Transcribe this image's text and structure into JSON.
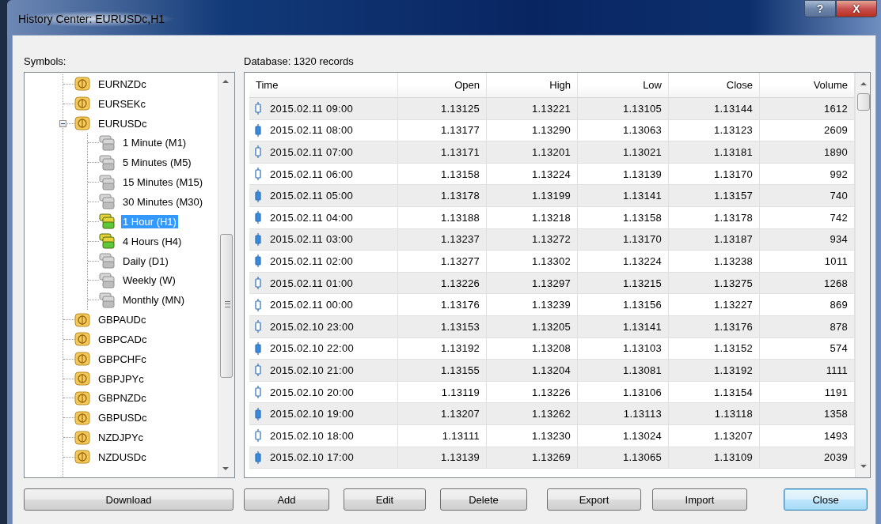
{
  "window": {
    "title": "History Center: EURUSDc,H1",
    "buttons": [
      {
        "kind": "help",
        "label": "?"
      },
      {
        "kind": "close",
        "label": "X"
      }
    ]
  },
  "symbols": {
    "label": "Symbols:",
    "items": [
      {
        "label": "EURNZDc",
        "selected": false
      },
      {
        "label": "EURSEKc",
        "selected": false
      },
      {
        "label": "EURUSDc",
        "selected": false,
        "expanded": true,
        "children": [
          {
            "label": "1 Minute (M1)",
            "selected": false,
            "has_data": false
          },
          {
            "label": "5 Minutes (M5)",
            "selected": false,
            "has_data": false
          },
          {
            "label": "15 Minutes (M15)",
            "selected": false,
            "has_data": false
          },
          {
            "label": "30 Minutes (M30)",
            "selected": false,
            "has_data": false
          },
          {
            "label": "1 Hour (H1)",
            "selected": true,
            "has_data": true
          },
          {
            "label": "4 Hours (H4)",
            "selected": false,
            "has_data": true
          },
          {
            "label": "Daily (D1)",
            "selected": false,
            "has_data": false
          },
          {
            "label": "Weekly (W)",
            "selected": false,
            "has_data": false
          },
          {
            "label": "Monthly (MN)",
            "selected": false,
            "has_data": false
          }
        ]
      },
      {
        "label": "GBPAUDc",
        "selected": false
      },
      {
        "label": "GBPCADc",
        "selected": false
      },
      {
        "label": "GBPCHFc",
        "selected": false
      },
      {
        "label": "GBPJPYc",
        "selected": false
      },
      {
        "label": "GBPNZDc",
        "selected": false
      },
      {
        "label": "GBPUSDc",
        "selected": false
      },
      {
        "label": "NZDJPYc",
        "selected": false
      },
      {
        "label": "NZDUSDc",
        "selected": false
      }
    ]
  },
  "database": {
    "label": "Database: 1320 records",
    "columns": [
      "Time",
      "Open",
      "High",
      "Low",
      "Close",
      "Volume"
    ],
    "rows": [
      {
        "bearish": false,
        "cells": [
          "2015.02.11 09:00",
          "1.13125",
          "1.13221",
          "1.13105",
          "1.13144",
          "1612"
        ]
      },
      {
        "bearish": true,
        "cells": [
          "2015.02.11 08:00",
          "1.13177",
          "1.13290",
          "1.13063",
          "1.13123",
          "2609"
        ]
      },
      {
        "bearish": false,
        "cells": [
          "2015.02.11 07:00",
          "1.13171",
          "1.13201",
          "1.13021",
          "1.13181",
          "1890"
        ]
      },
      {
        "bearish": false,
        "cells": [
          "2015.02.11 06:00",
          "1.13158",
          "1.13224",
          "1.13139",
          "1.13170",
          "992"
        ]
      },
      {
        "bearish": true,
        "cells": [
          "2015.02.11 05:00",
          "1.13178",
          "1.13199",
          "1.13141",
          "1.13157",
          "740"
        ]
      },
      {
        "bearish": true,
        "cells": [
          "2015.02.11 04:00",
          "1.13188",
          "1.13218",
          "1.13158",
          "1.13178",
          "742"
        ]
      },
      {
        "bearish": true,
        "cells": [
          "2015.02.11 03:00",
          "1.13237",
          "1.13272",
          "1.13170",
          "1.13187",
          "934"
        ]
      },
      {
        "bearish": true,
        "cells": [
          "2015.02.11 02:00",
          "1.13277",
          "1.13302",
          "1.13224",
          "1.13238",
          "1011"
        ]
      },
      {
        "bearish": false,
        "cells": [
          "2015.02.11 01:00",
          "1.13226",
          "1.13297",
          "1.13215",
          "1.13275",
          "1268"
        ]
      },
      {
        "bearish": false,
        "cells": [
          "2015.02.11 00:00",
          "1.13176",
          "1.13239",
          "1.13156",
          "1.13227",
          "869"
        ]
      },
      {
        "bearish": false,
        "cells": [
          "2015.02.10 23:00",
          "1.13153",
          "1.13205",
          "1.13141",
          "1.13176",
          "878"
        ]
      },
      {
        "bearish": true,
        "cells": [
          "2015.02.10 22:00",
          "1.13192",
          "1.13208",
          "1.13103",
          "1.13152",
          "574"
        ]
      },
      {
        "bearish": false,
        "cells": [
          "2015.02.10 21:00",
          "1.13155",
          "1.13204",
          "1.13081",
          "1.13192",
          "1111"
        ]
      },
      {
        "bearish": false,
        "cells": [
          "2015.02.10 20:00",
          "1.13119",
          "1.13226",
          "1.13106",
          "1.13154",
          "1191"
        ]
      },
      {
        "bearish": true,
        "cells": [
          "2015.02.10 19:00",
          "1.13207",
          "1.13262",
          "1.13113",
          "1.13118",
          "1358"
        ]
      },
      {
        "bearish": false,
        "cells": [
          "2015.02.10 18:00",
          "1.13111",
          "1.13230",
          "1.13024",
          "1.13207",
          "1493"
        ]
      },
      {
        "bearish": true,
        "cells": [
          "2015.02.10 17:00",
          "1.13139",
          "1.13269",
          "1.13065",
          "1.13109",
          "2039"
        ]
      }
    ]
  },
  "buttons": [
    {
      "label": "Download",
      "default": false
    },
    {
      "label": "Add",
      "default": false
    },
    {
      "label": "Edit",
      "default": false
    },
    {
      "label": "Delete",
      "default": false
    },
    {
      "label": "Export",
      "default": false
    },
    {
      "label": "Import",
      "default": false
    },
    {
      "label": "Close",
      "default": true
    }
  ]
}
